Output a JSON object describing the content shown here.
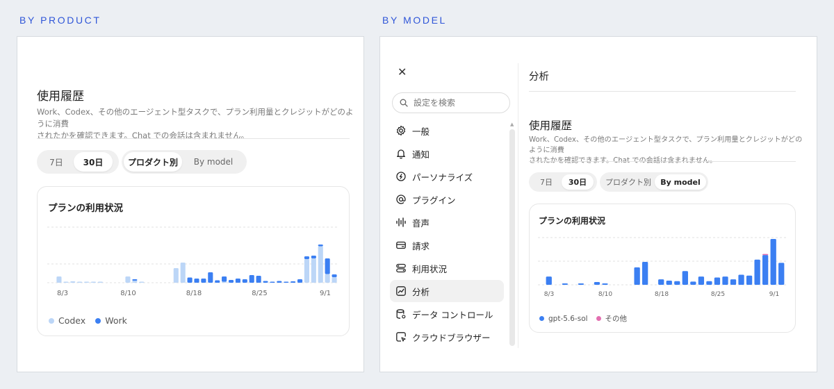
{
  "left": {
    "section_label": "BY PRODUCT",
    "title": "使用履歴",
    "description_line1": "Work、Codex、その他のエージェント型タスクで、プラン利用量とクレジットがどのように消費",
    "description_line2": "されたかを確認できます。Chat での会話は含まれません。",
    "range_tabs": [
      {
        "label": "7日",
        "active": false
      },
      {
        "label": "30日",
        "active": true
      }
    ],
    "group_tabs": [
      {
        "label": "プロダクト別",
        "active": true
      },
      {
        "label": "By model",
        "active": false
      }
    ],
    "card_title": "プランの利用状況",
    "legend": [
      {
        "label": "Codex",
        "color": "#bcd6f7"
      },
      {
        "label": "Work",
        "color": "#3b7ff2"
      }
    ]
  },
  "right": {
    "section_label": "BY MODEL",
    "close_icon": "close-icon",
    "search_placeholder": "設定を検索",
    "nav_items": [
      {
        "label": "一般",
        "icon": "gear-icon",
        "active": false
      },
      {
        "label": "通知",
        "icon": "bell-icon",
        "active": false
      },
      {
        "label": "パーソナライズ",
        "icon": "personalize-icon",
        "active": false
      },
      {
        "label": "プラグイン",
        "icon": "at-icon",
        "active": false
      },
      {
        "label": "音声",
        "icon": "waveform-icon",
        "active": false
      },
      {
        "label": "請求",
        "icon": "card-icon",
        "active": false
      },
      {
        "label": "利用状況",
        "icon": "toggles-icon",
        "active": false
      },
      {
        "label": "分析",
        "icon": "analytics-icon",
        "active": true
      },
      {
        "label": "データ コントロール",
        "icon": "data-icon",
        "active": false
      },
      {
        "label": "クラウドブラウザー",
        "icon": "browser-icon",
        "active": false
      }
    ],
    "page_header": "分析",
    "title": "使用履歴",
    "description_line1": "Work、Codex、その他のエージェント型タスクで、プラン利用量とクレジットがどのように消費",
    "description_line2": "されたかを確認できます。Chat での会話は含まれません。",
    "range_tabs": [
      {
        "label": "7日",
        "active": false
      },
      {
        "label": "30日",
        "active": true
      }
    ],
    "group_tabs": [
      {
        "label": "プロダクト別",
        "active": false
      },
      {
        "label": "By model",
        "active": true
      }
    ],
    "card_title": "プランの利用状況",
    "legend": [
      {
        "label": "gpt-5.6-sol",
        "color": "#3b7ff2"
      },
      {
        "label": "その他",
        "color": "#e36fb0"
      }
    ]
  },
  "chart_data": [
    {
      "type": "bar",
      "stacked": true,
      "x_tick_labels": [
        "8/3",
        "8/10",
        "8/18",
        "8/25",
        "9/1"
      ],
      "grid": true,
      "legend_placement": "bottom-left",
      "series": [
        {
          "name": "Codex",
          "color": "#bcd6f7",
          "values": [
            0.18,
            0.03,
            0.04,
            0.03,
            0.03,
            0.02,
            0.02,
            0,
            0,
            0,
            0.18,
            0.06,
            0.02,
            0,
            0,
            0,
            0,
            0.42,
            0.58,
            0,
            0,
            0,
            0,
            0,
            0.02,
            0,
            0,
            0,
            0,
            0,
            0,
            0,
            0,
            0,
            0,
            0,
            0.68,
            0.7,
            1.05,
            0.25,
            0.16
          ]
        },
        {
          "name": "Work",
          "color": "#3b7ff2",
          "values": [
            0,
            0,
            0,
            0,
            0,
            0,
            0,
            0,
            0,
            0,
            0,
            0.04,
            0,
            0,
            0,
            0,
            0,
            0,
            0,
            0.15,
            0.12,
            0.12,
            0.3,
            0.07,
            0.15,
            0.08,
            0.12,
            0.1,
            0.22,
            0.2,
            0.05,
            0.03,
            0.05,
            0.02,
            0.04,
            0.1,
            0.08,
            0.08,
            0.05,
            0.45,
            0.08
          ]
        }
      ]
    },
    {
      "type": "bar",
      "stacked": true,
      "x_tick_labels": [
        "8/3",
        "8/10",
        "8/18",
        "8/25",
        "9/1"
      ],
      "grid": true,
      "legend_placement": "bottom-left",
      "series": [
        {
          "name": "gpt-5.6-sol",
          "color": "#3b7ff2",
          "values": [
            0.18,
            0,
            0.03,
            0,
            0.03,
            0,
            0.06,
            0.03,
            0,
            0,
            0,
            0.38,
            0.5,
            0,
            0.12,
            0.09,
            0.08,
            0.3,
            0.07,
            0.18,
            0.08,
            0.16,
            0.18,
            0.12,
            0.22,
            0.2,
            0.55,
            0.65,
            1.0,
            0.48
          ]
        },
        {
          "name": "その他",
          "color": "#e36fb0",
          "values": [
            0,
            0,
            0,
            0,
            0,
            0,
            0,
            0,
            0,
            0,
            0,
            0,
            0,
            0,
            0,
            0,
            0,
            0,
            0,
            0,
            0,
            0,
            0,
            0,
            0,
            0,
            0,
            0.02,
            0,
            0
          ]
        }
      ]
    }
  ]
}
